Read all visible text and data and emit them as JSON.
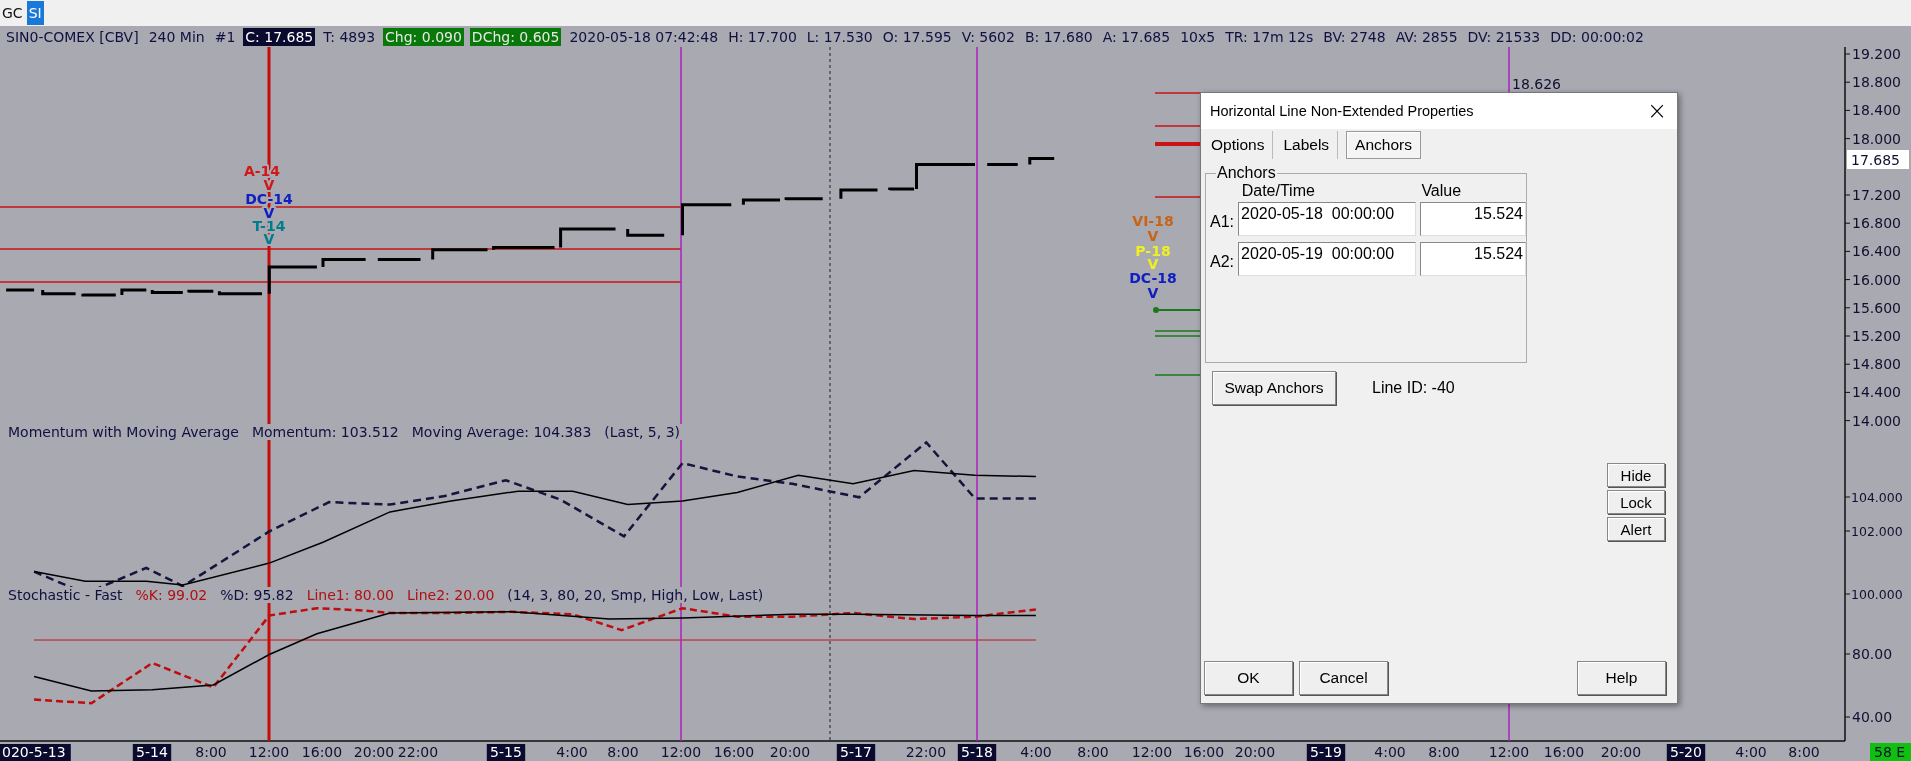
{
  "symbol_tabs": [
    {
      "label": "GC",
      "selected": false
    },
    {
      "label": "SI",
      "selected": true
    }
  ],
  "header": {
    "items": [
      {
        "text": "SIN0-COMEX [CBV]",
        "kind": "plain"
      },
      {
        "text": "240 Min",
        "kind": "plain"
      },
      {
        "text": "#1",
        "kind": "plain"
      },
      {
        "text": "C: 17.685",
        "kind": "last"
      },
      {
        "text": "T: 4893",
        "kind": "plain"
      },
      {
        "text": "Chg: 0.090",
        "kind": "change"
      },
      {
        "text": "DChg: 0.605",
        "kind": "change"
      },
      {
        "text": "2020-05-18 07:42:48",
        "kind": "plain"
      },
      {
        "text": "H: 17.700",
        "kind": "plain"
      },
      {
        "text": "L: 17.530",
        "kind": "plain"
      },
      {
        "text": "O: 17.595",
        "kind": "plain"
      },
      {
        "text": "V: 5602",
        "kind": "plain"
      },
      {
        "text": "B: 17.680",
        "kind": "plain"
      },
      {
        "text": "A: 17.685",
        "kind": "plain"
      },
      {
        "text": "10x5",
        "kind": "plain"
      },
      {
        "text": "TR: 17m 12s",
        "kind": "plain"
      },
      {
        "text": "BV: 2748",
        "kind": "plain"
      },
      {
        "text": "AV: 2855",
        "kind": "plain"
      },
      {
        "text": "DV: 21533",
        "kind": "plain"
      },
      {
        "text": "DD: 00:00:02",
        "kind": "plain"
      }
    ]
  },
  "markers": [
    {
      "text": "A-14",
      "color": "#d01818"
    },
    {
      "text": "V",
      "color": "#d01818"
    },
    {
      "text": "DC-14",
      "color": "#1020c0"
    },
    {
      "text": "V",
      "color": "#1020c0"
    },
    {
      "text": "T-14",
      "color": "#007c8c"
    },
    {
      "text": "V",
      "color": "#007c8c"
    },
    {
      "text": "VI-18",
      "color": "#c86414"
    },
    {
      "text": "V",
      "color": "#c86414"
    },
    {
      "text": "P-18",
      "color": "#f0f020"
    },
    {
      "text": "V",
      "color": "#f0f020"
    },
    {
      "text": "DC-18",
      "color": "#1020c0"
    },
    {
      "text": "V",
      "color": "#1020c0"
    }
  ],
  "level_label": "18.626",
  "momentum_legend": [
    {
      "text": "Momentum with Moving Average",
      "color": "#101040"
    },
    {
      "text": "Momentum: 103.512",
      "color": "#101040"
    },
    {
      "text": "Moving Average: 104.383",
      "color": "#101040"
    },
    {
      "text": "(Last, 5, 3)",
      "color": "#101040"
    }
  ],
  "stochastic_legend": [
    {
      "text": "Stochastic - Fast",
      "color": "#101040"
    },
    {
      "text": "%K: 99.02",
      "color": "#b01010"
    },
    {
      "text": "%D: 95.82",
      "color": "#101040"
    },
    {
      "text": "Line1: 80.00",
      "color": "#b01010"
    },
    {
      "text": "Line2: 20.00",
      "color": "#b01010"
    },
    {
      "text": "(14, 3, 80, 20, Smp, High, Low, Last)",
      "color": "#101040"
    }
  ],
  "price_axis": {
    "labels": [
      "19.200",
      "18.800",
      "18.400",
      "18.000",
      "17.200",
      "16.800",
      "16.400",
      "16.000",
      "15.600",
      "15.200",
      "14.800",
      "14.400",
      "14.000"
    ],
    "current": "17.685"
  },
  "momentum_axis": {
    "labels": [
      "104.000",
      "102.000",
      "100.000"
    ]
  },
  "stochastic_axis": {
    "labels": [
      "80.00",
      "40.00"
    ]
  },
  "time_axis": {
    "labels": [
      {
        "text": "020-5-13",
        "kind": "date"
      },
      {
        "text": "5-14",
        "kind": "date"
      },
      {
        "text": "8:00",
        "kind": "time"
      },
      {
        "text": "12:00",
        "kind": "time"
      },
      {
        "text": "16:00",
        "kind": "time"
      },
      {
        "text": "20:00",
        "kind": "time"
      },
      {
        "text": "22:00",
        "kind": "time"
      },
      {
        "text": "5-15",
        "kind": "date"
      },
      {
        "text": "4:00",
        "kind": "time"
      },
      {
        "text": "8:00",
        "kind": "time"
      },
      {
        "text": "12:00",
        "kind": "time"
      },
      {
        "text": "16:00",
        "kind": "time"
      },
      {
        "text": "20:00",
        "kind": "time"
      },
      {
        "text": "5-17",
        "kind": "date"
      },
      {
        "text": "22:00",
        "kind": "time"
      },
      {
        "text": "5-18",
        "kind": "date"
      },
      {
        "text": "4:00",
        "kind": "time"
      },
      {
        "text": "8:00",
        "kind": "time"
      },
      {
        "text": "12:00",
        "kind": "time"
      },
      {
        "text": "16:00",
        "kind": "time"
      },
      {
        "text": "20:00",
        "kind": "time"
      },
      {
        "text": "5-19",
        "kind": "date"
      },
      {
        "text": "4:00",
        "kind": "time"
      },
      {
        "text": "8:00",
        "kind": "time"
      },
      {
        "text": "12:00",
        "kind": "time"
      },
      {
        "text": "16:00",
        "kind": "time"
      },
      {
        "text": "20:00",
        "kind": "time"
      },
      {
        "text": "5-20",
        "kind": "date"
      },
      {
        "text": "4:00",
        "kind": "time"
      },
      {
        "text": "8:00",
        "kind": "time"
      }
    ],
    "status": "58 E"
  },
  "dialog": {
    "title": "Horizontal Line Non-Extended Properties",
    "close": "×",
    "tabs": [
      {
        "label": "Options",
        "selected": false
      },
      {
        "label": "Labels",
        "selected": false
      },
      {
        "label": "Anchors",
        "selected": true
      }
    ],
    "group": "Anchors",
    "columns": [
      "Date/Time",
      "Value"
    ],
    "anchors": [
      {
        "label": "A1:",
        "datetime": "2020-05-18  00:00:00",
        "value": "15.524"
      },
      {
        "label": "A2:",
        "datetime": "2020-05-19  00:00:00",
        "value": "15.524"
      }
    ],
    "swap_button": "Swap Anchors",
    "line_id": "Line ID: -40",
    "side_buttons": [
      "Hide",
      "Lock",
      "Alert"
    ],
    "ok": "OK",
    "cancel": "Cancel",
    "help": "Help"
  }
}
